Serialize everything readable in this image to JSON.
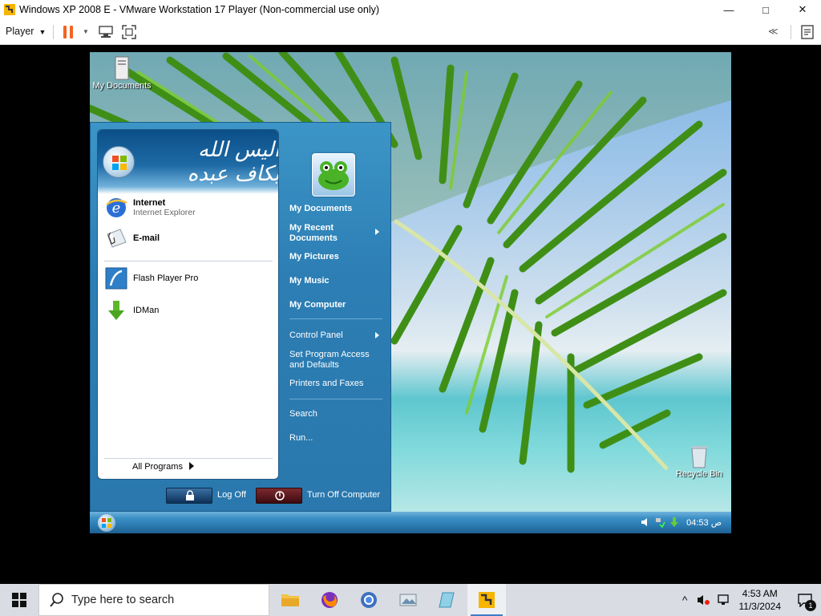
{
  "window": {
    "title": "Windows XP 2008 E - VMware Workstation 17 Player (Non-commercial use only)",
    "minimize": "—",
    "maximize": "□",
    "close": "✕"
  },
  "toolbar": {
    "player_label": "Player",
    "player_caret": "▼",
    "pause_caret": "▼",
    "collapse_label": "≪"
  },
  "desktop": {
    "icons": [
      {
        "label": "My Documents"
      },
      {
        "label": "Recycle Bin"
      }
    ]
  },
  "start_menu": {
    "header_calligraphy": "الیس الله بکاف عبده",
    "pinned": [
      {
        "title": "Internet",
        "subtitle": "Internet Explorer",
        "icon": "ie-icon"
      },
      {
        "title": "E-mail",
        "icon": "email-icon"
      }
    ],
    "recent": [
      {
        "label": "Flash Player Pro",
        "icon": "flash-icon"
      },
      {
        "label": "IDMan",
        "icon": "download-arrow-icon"
      }
    ],
    "all_programs": "All Programs",
    "right": {
      "my_documents": "My Documents",
      "my_recent_documents": "My Recent Documents",
      "my_pictures": "My Pictures",
      "my_music": "My Music",
      "my_computer": "My Computer",
      "control_panel": "Control Panel",
      "set_program_access": "Set Program Access and Defaults",
      "printers_and_faxes": "Printers and Faxes",
      "search": "Search",
      "run": "Run..."
    },
    "log_off": "Log Off",
    "turn_off": "Turn Off Computer"
  },
  "xp_taskbar": {
    "clock": "04:53 ص"
  },
  "host_taskbar": {
    "search_placeholder": "Type here to search",
    "time": "4:53 AM",
    "date": "11/3/2024",
    "notification_count": "1",
    "tray_chevron": "^"
  }
}
